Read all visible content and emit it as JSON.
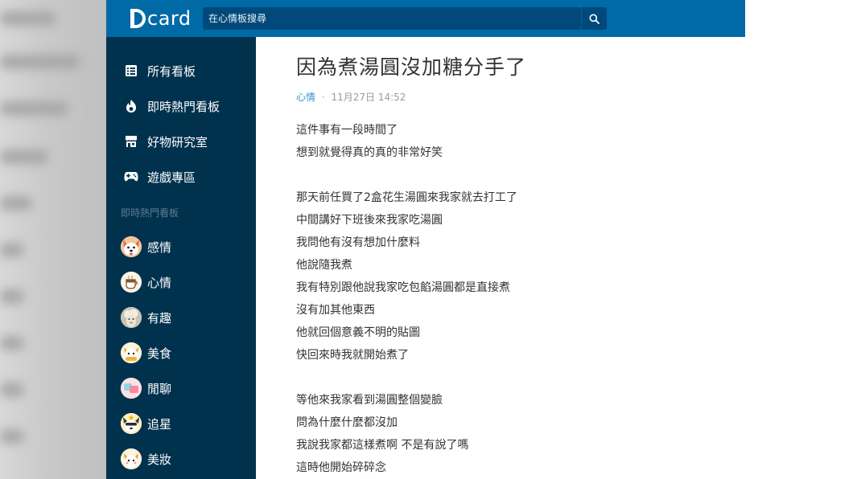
{
  "header": {
    "logo_text": "card",
    "search": {
      "placeholder": "在心情板搜尋"
    }
  },
  "sidebar": {
    "nav": [
      {
        "label": "所有看板",
        "icon": "list-icon"
      },
      {
        "label": "即時熱門看板",
        "icon": "flame-icon"
      },
      {
        "label": "好物研究室",
        "icon": "shop-icon"
      },
      {
        "label": "遊戲專區",
        "icon": "gamepad-icon"
      }
    ],
    "section_title": "即時熱門看板",
    "forums": [
      {
        "label": "感情",
        "icon": "dog-avatar-icon"
      },
      {
        "label": "心情",
        "icon": "cup-avatar-icon"
      },
      {
        "label": "有趣",
        "icon": "alpaca-avatar-icon"
      },
      {
        "label": "美食",
        "icon": "food-avatar-icon"
      },
      {
        "label": "閒聊",
        "icon": "chat-avatar-icon"
      },
      {
        "label": "追星",
        "icon": "star-dog-avatar-icon"
      },
      {
        "label": "美妝",
        "icon": "makeup-avatar-icon"
      }
    ]
  },
  "post": {
    "title": "因為煮湯圓沒加糖分手了",
    "forum": "心情",
    "separator": "·",
    "timestamp": "11月27日 14:52",
    "body_lines": [
      "這件事有一段時間了",
      "想到就覺得真的真的非常好笑",
      "",
      "那天前任買了2盒花生湯圓來我家就去打工了",
      "中間講好下班後來我家吃湯圓",
      "我問他有沒有想加什麼料",
      "他說隨我煮",
      "我有特別跟他說我家吃包餡湯圓都是直接煮",
      "沒有加其他東西",
      "他就回個意義不明的貼圖",
      "快回來時我就開始煮了",
      "",
      "等他來我家看到湯圓整個變臉",
      "問為什麼什麼都沒加",
      "我說我家都這樣煮啊 不是有說了嗎",
      "這時他開始碎碎念"
    ]
  }
}
